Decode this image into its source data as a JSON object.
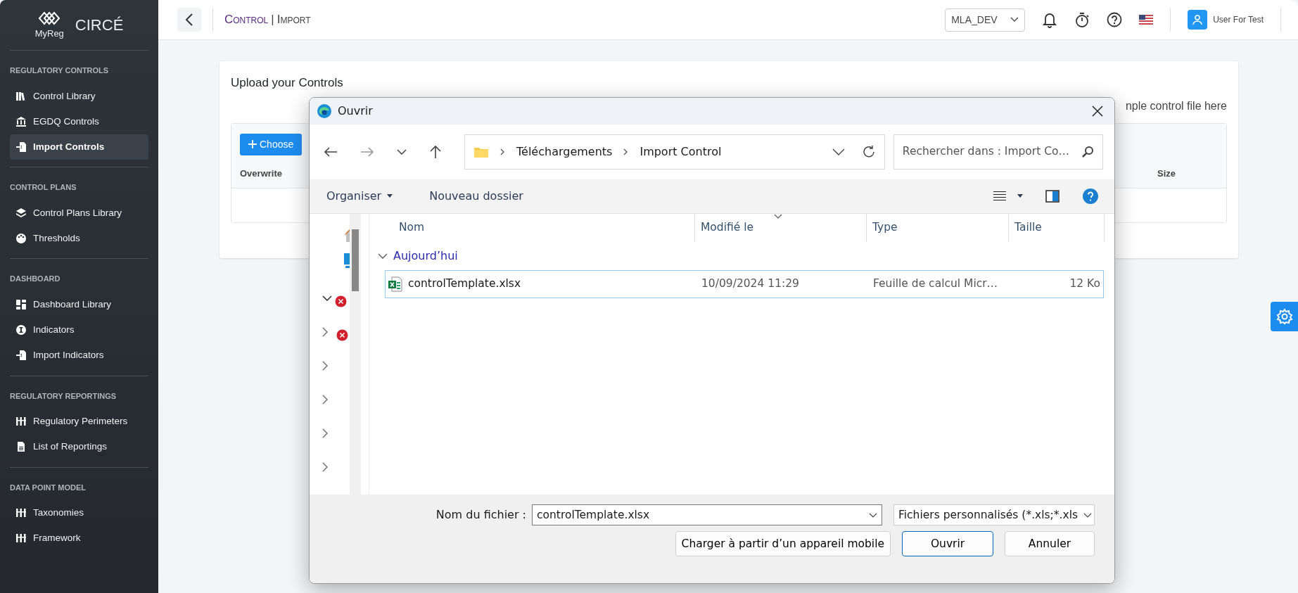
{
  "app": {
    "logo_text": "MyReg",
    "brand": "CIRCÉ"
  },
  "sidebar": {
    "sections": [
      {
        "title": "REGULATORY CONTROLS",
        "items": [
          {
            "label": "Control Library",
            "selected": false
          },
          {
            "label": "EGDQ Controls",
            "selected": false
          },
          {
            "label": "Import Controls",
            "selected": true
          }
        ]
      },
      {
        "title": "CONTROL PLANS",
        "items": [
          {
            "label": "Control Plans Library",
            "selected": false
          },
          {
            "label": "Thresholds",
            "selected": false
          }
        ]
      },
      {
        "title": "DASHBOARD",
        "items": [
          {
            "label": "Dashboard Library",
            "selected": false
          },
          {
            "label": "Indicators",
            "selected": false
          },
          {
            "label": "Import Indicators",
            "selected": false
          }
        ]
      },
      {
        "title": "REGULATORY REPORTINGS",
        "items": [
          {
            "label": "Regulatory Perimeters",
            "selected": false
          },
          {
            "label": "List of Reportings",
            "selected": false
          }
        ]
      },
      {
        "title": "DATA POINT MODEL",
        "items": [
          {
            "label": "Taxonomies",
            "selected": false
          },
          {
            "label": "Framework",
            "selected": false
          }
        ]
      }
    ]
  },
  "topbar": {
    "breadcrumb": [
      "Control",
      "Import"
    ],
    "separator": "|",
    "environment": "MLA_DEV",
    "user": "User For Test"
  },
  "card": {
    "title": "Upload your Controls",
    "hint": "nple control file here",
    "choose_button": "Choose",
    "columns": [
      "Overwrite",
      "Size"
    ]
  },
  "dialog": {
    "title": "Ouvrir",
    "path": [
      "Téléchargements",
      "Import Control"
    ],
    "search": {
      "placeholder": "Rechercher dans : Import Co…"
    },
    "commands": {
      "organise": "Organiser",
      "new_folder": "Nouveau dossier"
    },
    "nav_pane": [
      {
        "expanded": true,
        "error": true
      },
      {
        "expanded": false,
        "error": true
      },
      {
        "expanded": false,
        "error": false
      },
      {
        "expanded": false,
        "error": false
      },
      {
        "expanded": false,
        "error": false
      },
      {
        "expanded": false,
        "error": false
      }
    ],
    "columns": [
      {
        "label": "Nom",
        "sorted": false
      },
      {
        "label": "Modifié le",
        "sorted": true
      },
      {
        "label": "Type",
        "sorted": false
      },
      {
        "label": "Taille",
        "sorted": false
      }
    ],
    "groups": [
      {
        "label": "Aujourd’hui",
        "expanded": true,
        "files": [
          {
            "name": "controlTemplate.xlsx",
            "modified": "10/09/2024 11:29",
            "type": "Feuille de calcul Micr…",
            "size": "12 Ko",
            "selected": true
          }
        ]
      }
    ],
    "filename_label": "Nom du fichier :",
    "filename": "controlTemplate.xlsx",
    "filter": "Fichiers personnalisés (*.xls;*.xls",
    "buttons": {
      "mobile": "Charger à partir d’un appareil mobile",
      "open": "Ouvrir",
      "cancel": "Annuler"
    }
  }
}
